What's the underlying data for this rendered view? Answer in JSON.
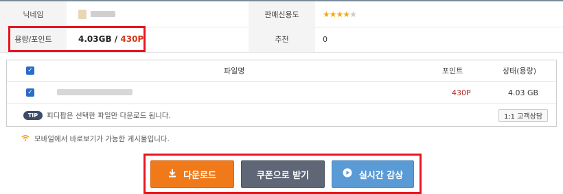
{
  "info": {
    "nickname_label": "닉네임",
    "seller_rating_label": "판매신용도",
    "seller_rating_stars": 4,
    "seller_rating_max": 5,
    "capacity_label": "용량/포인트",
    "capacity_size": "4.03GB",
    "capacity_separator": "/",
    "capacity_points": "430P",
    "recommend_label": "추천",
    "recommend_value": "0"
  },
  "files": {
    "header": {
      "name": "파일명",
      "points": "포인트",
      "status": "상태(용량)"
    },
    "rows": [
      {
        "points": "430P",
        "size": "4.03 GB"
      }
    ],
    "tip_badge": "TIP",
    "tip_text": "피디팝은 선택한 파일만 다운로드 됩니다.",
    "consult_button": "1:1 고객상담"
  },
  "mobile_note": "모바일에서 바로보기가 가능한 게시물입니다.",
  "actions": {
    "download": "다운로드",
    "coupon": "쿠폰으로 받기",
    "live": "실시간 감상"
  },
  "colors": {
    "highlight_frame": "#e8141e",
    "download_button": "#f07a1a",
    "coupon_button": "#5f6676",
    "live_button": "#5b9bd5",
    "points_red": "#d33a1c"
  }
}
